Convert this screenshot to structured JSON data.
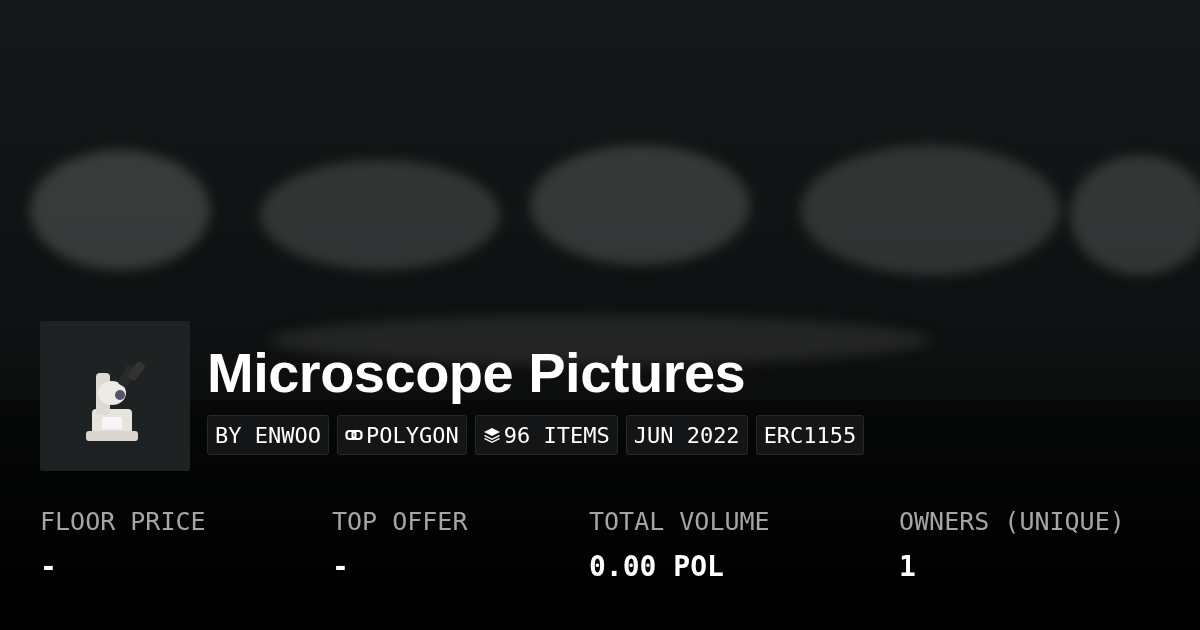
{
  "title": "Microscope Pictures",
  "badges": [
    {
      "kind": "plain",
      "label": "BY ENWOO"
    },
    {
      "kind": "chain",
      "label": "POLYGON"
    },
    {
      "kind": "items",
      "label": "96 ITEMS"
    },
    {
      "kind": "plain",
      "label": "JUN 2022"
    },
    {
      "kind": "plain",
      "label": "ERC1155"
    }
  ],
  "stats": [
    {
      "label": "FLOOR PRICE",
      "value": "-"
    },
    {
      "label": "TOP OFFER",
      "value": "-"
    },
    {
      "label": "TOTAL VOLUME",
      "value": "0.00 POL"
    },
    {
      "label": "OWNERS (UNIQUE)",
      "value": "1"
    }
  ]
}
